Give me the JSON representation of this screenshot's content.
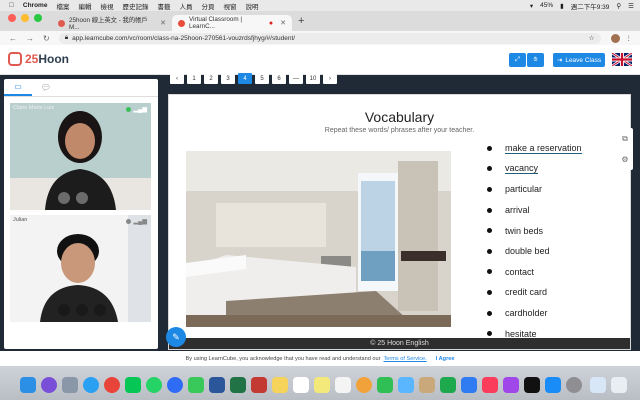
{
  "menubar": {
    "items": [
      "Chrome",
      "檔案",
      "編輯",
      "檢視",
      "歷史記錄",
      "書籤",
      "人員",
      "分頁",
      "視窗",
      "說明"
    ],
    "battery": "45%",
    "clock": "週二下午9:39"
  },
  "browser": {
    "tabs": [
      {
        "title": "25hoon 線上英文 - 我的帳戶 M..."
      },
      {
        "title": "Virtual Classroom | LearnC..."
      }
    ],
    "new_tab": "+",
    "url": "app.learncube.com/vc/room/class-na-25hoon-270561-vouzrdsfjhyg/#/student/"
  },
  "app": {
    "logo_prefix": "25",
    "logo_name": "Hoon",
    "leave_label": "Leave Class",
    "colors": {
      "accent": "#1e88e5",
      "brand": "#e05a4f"
    }
  },
  "panel": {
    "teacher_name": "Claire Marie Luis",
    "student_name": "Julian"
  },
  "pager": {
    "pages": [
      "‹",
      "1",
      "2",
      "3",
      "4",
      "5",
      "6",
      "—",
      "10",
      "›"
    ],
    "current": "4"
  },
  "slide": {
    "title": "Vocabulary",
    "subtitle": "Repeat these words/ phrases after your teacher.",
    "words": [
      "make a reservation",
      "vacancy",
      "particular",
      "arrival",
      "twin beds",
      "double bed",
      "contact",
      "credit card",
      "cardholder",
      "hesitate"
    ],
    "footer": "© 25 Hoon English"
  },
  "cookie": {
    "text": "By using LearnCube, you acknowledge that you have read and understand our",
    "link": "Terms of Service.",
    "agree": "I Agree"
  }
}
